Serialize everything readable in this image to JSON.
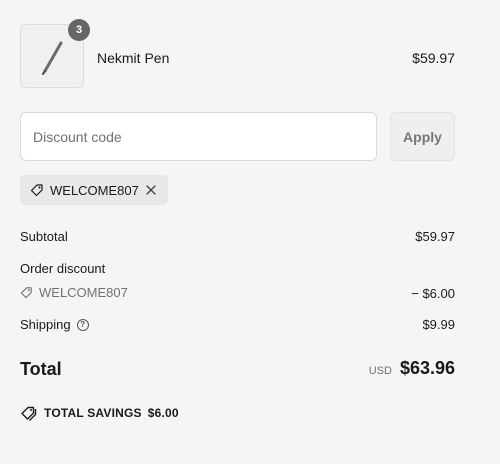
{
  "product": {
    "name": "Nekmit Pen",
    "quantity": "3",
    "price": "$59.97"
  },
  "discount": {
    "placeholder": "Discount code",
    "apply_label": "Apply",
    "applied_code": "WELCOME807"
  },
  "summary": {
    "subtotal_label": "Subtotal",
    "subtotal_value": "$59.97",
    "order_discount_label": "Order discount",
    "order_discount_code": "WELCOME807",
    "order_discount_value": "− $6.00",
    "shipping_label": "Shipping",
    "shipping_value": "$9.99",
    "total_label": "Total",
    "currency": "USD",
    "total_value": "$63.96",
    "savings_label": "TOTAL SAVINGS",
    "savings_value": "$6.00"
  },
  "icons": {
    "product": "pen-image",
    "tag": "tag-icon",
    "remove": "close-icon",
    "info": "info-icon",
    "savings": "tags-icon"
  }
}
